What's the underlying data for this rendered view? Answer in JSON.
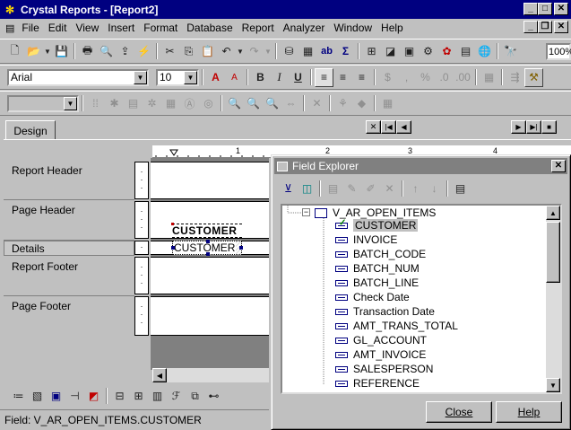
{
  "window": {
    "title": "Crystal Reports - [Report2]"
  },
  "menu": [
    "File",
    "Edit",
    "View",
    "Insert",
    "Format",
    "Database",
    "Report",
    "Analyzer",
    "Window",
    "Help"
  ],
  "toolbar": {
    "font": "Arial",
    "size": "10",
    "zoom": "100%"
  },
  "design": {
    "tab": "Design",
    "sections": [
      "Report Header",
      "Page Header",
      "Details",
      "Report Footer",
      "Page Footer"
    ],
    "header_field": "CUSTOMER",
    "detail_field": "CUSTOMER"
  },
  "status": {
    "text": "Field: V_AR_OPEN_ITEMS.CUSTOMER"
  },
  "field_explorer": {
    "title": "Field Explorer",
    "table": "V_AR_OPEN_ITEMS",
    "fields": [
      "CUSTOMER",
      "INVOICE",
      "BATCH_CODE",
      "BATCH_NUM",
      "BATCH_LINE",
      "Check Date",
      "Transaction Date",
      "AMT_TRANS_TOTAL",
      "GL_ACCOUNT",
      "AMT_INVOICE",
      "SALESPERSON",
      "REFERENCE"
    ],
    "close_label": "Close",
    "help_label": "Help"
  }
}
